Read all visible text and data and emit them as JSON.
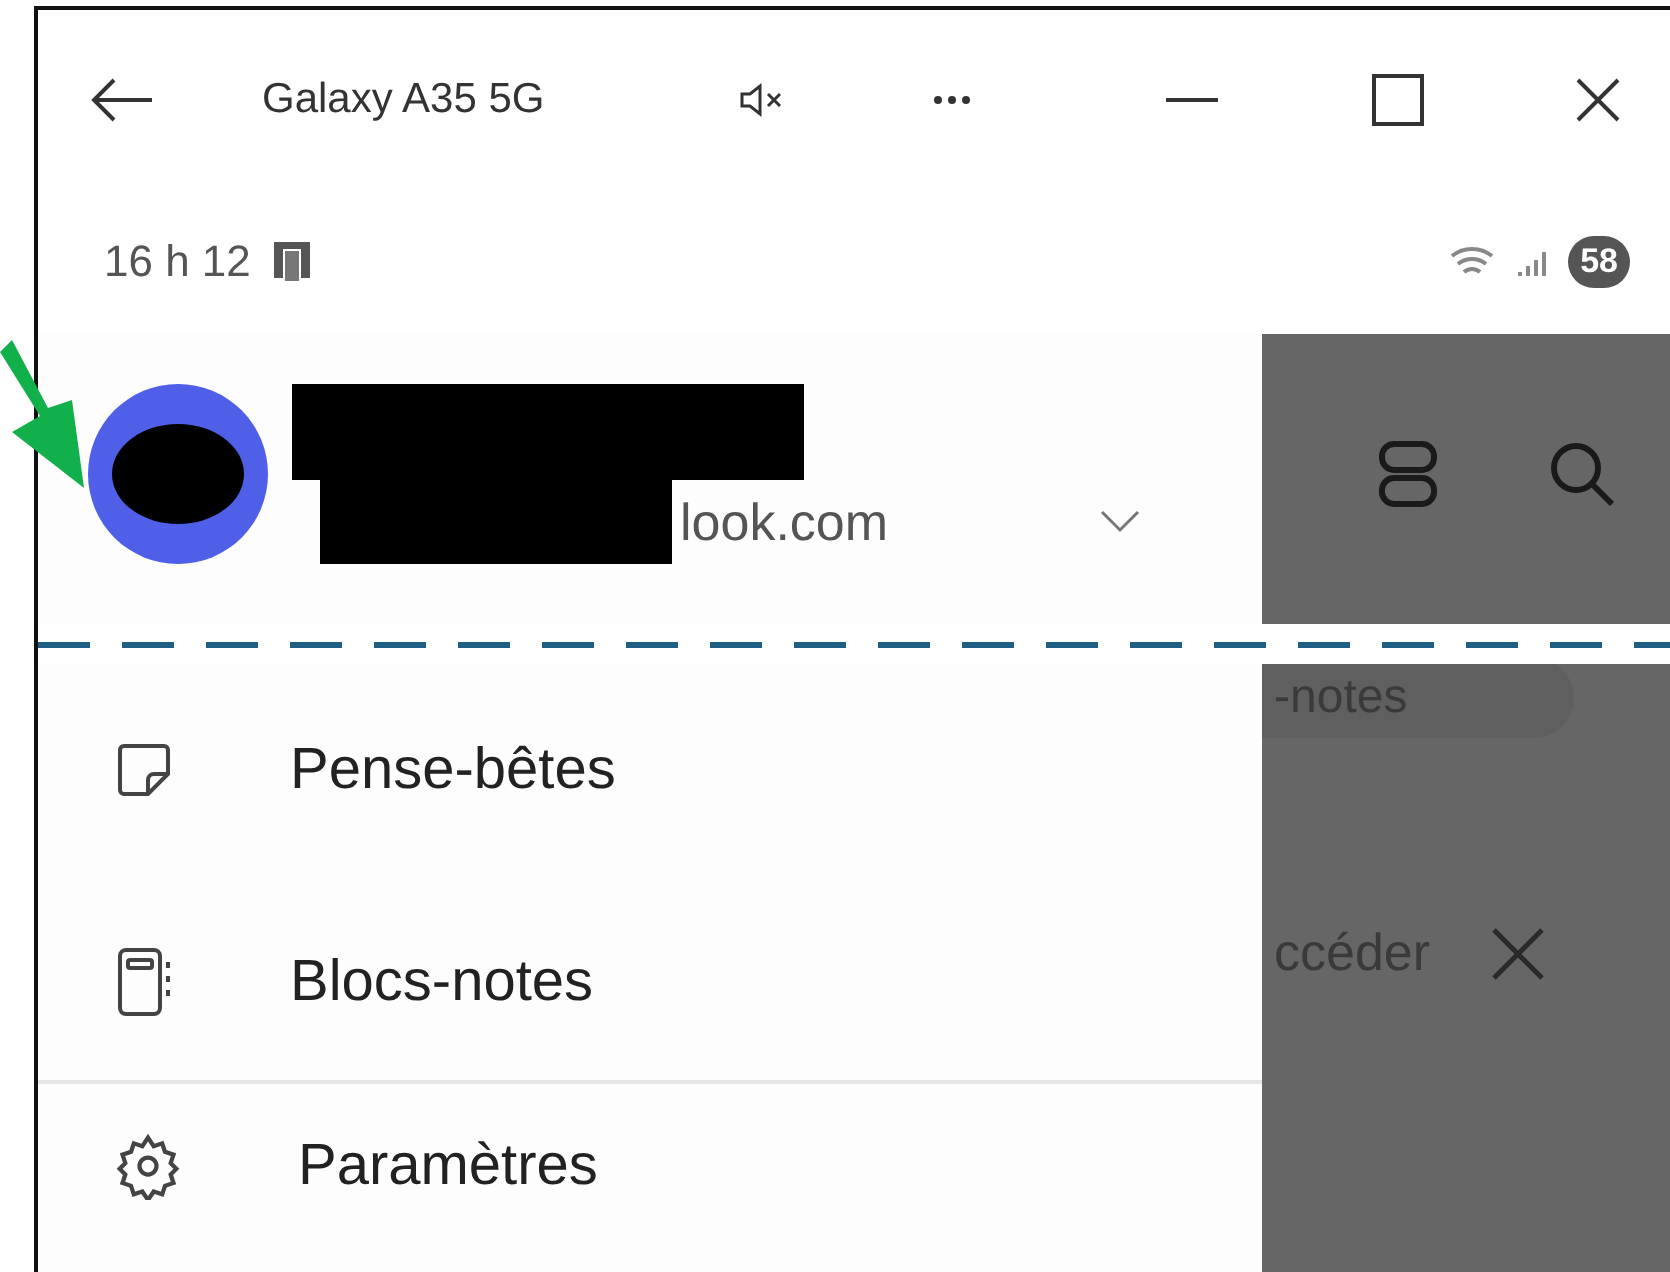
{
  "window": {
    "title": "Galaxy A35 5G"
  },
  "status_bar": {
    "time": "16 h 12",
    "battery": "58"
  },
  "account": {
    "email_visible": "look.com"
  },
  "menu": [
    {
      "kind": "sticky-note",
      "label": "Pense-bêtes"
    },
    {
      "kind": "notebook",
      "label": "Blocs-notes"
    },
    {
      "kind": "gear",
      "label": "Paramètres"
    }
  ],
  "background_app": {
    "chip": "-notes",
    "banner": "ccéder"
  }
}
